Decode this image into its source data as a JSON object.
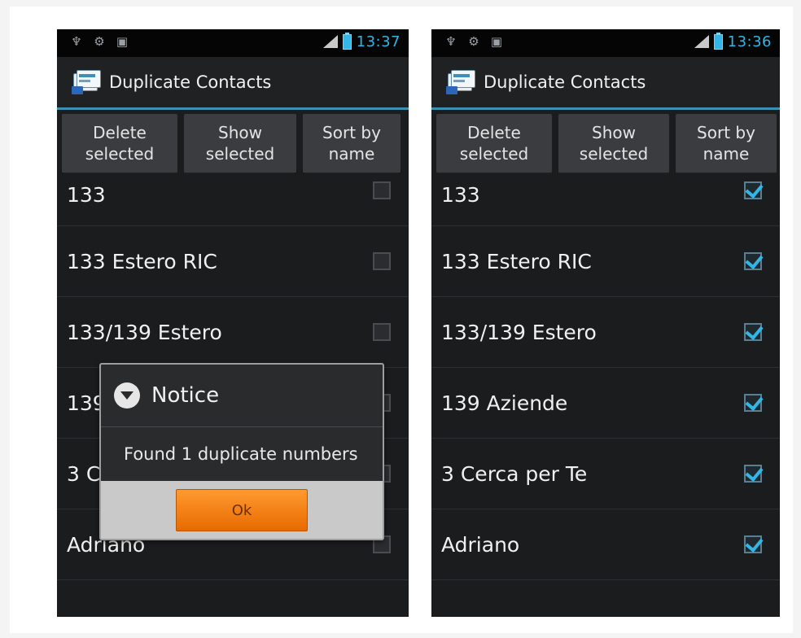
{
  "screens": [
    {
      "status_time": "13:37",
      "app_title": "Duplicate Contacts",
      "buttons": {
        "delete_line1": "Delete",
        "delete_line2": "selected",
        "show_line1": "Show",
        "show_line2": "selected",
        "sort_line1": "Sort by",
        "sort_line2": "name"
      },
      "rows": [
        "133",
        "133 Estero RIC",
        "133/139 Estero",
        "139 Aziende",
        "3 Cerca per Te",
        "Adriano"
      ],
      "dialog": {
        "title": "Notice",
        "message": "Found 1 duplicate numbers",
        "ok_label": "Ok"
      }
    },
    {
      "status_time": "13:36",
      "app_title": "Duplicate Contacts",
      "buttons": {
        "delete_line1": "Delete",
        "delete_line2": "selected",
        "show_line1": "Show",
        "show_line2": "selected",
        "sort_line1": "Sort by",
        "sort_line2": "name"
      },
      "rows": [
        "133",
        "133 Estero RIC",
        "133/139 Estero",
        "139 Aziende",
        "3 Cerca per Te",
        "Adriano"
      ],
      "checked": [
        true,
        true,
        true,
        true,
        true,
        true
      ]
    }
  ],
  "icons": {
    "status_left": [
      "usb-icon",
      "android-debug-icon",
      "briefcase-icon"
    ],
    "status_right": [
      "signal-icon",
      "battery-icon"
    ]
  },
  "colors": {
    "accent": "#33b5e5",
    "ok_button": "#f07a10",
    "background": "#1b1c1e"
  }
}
